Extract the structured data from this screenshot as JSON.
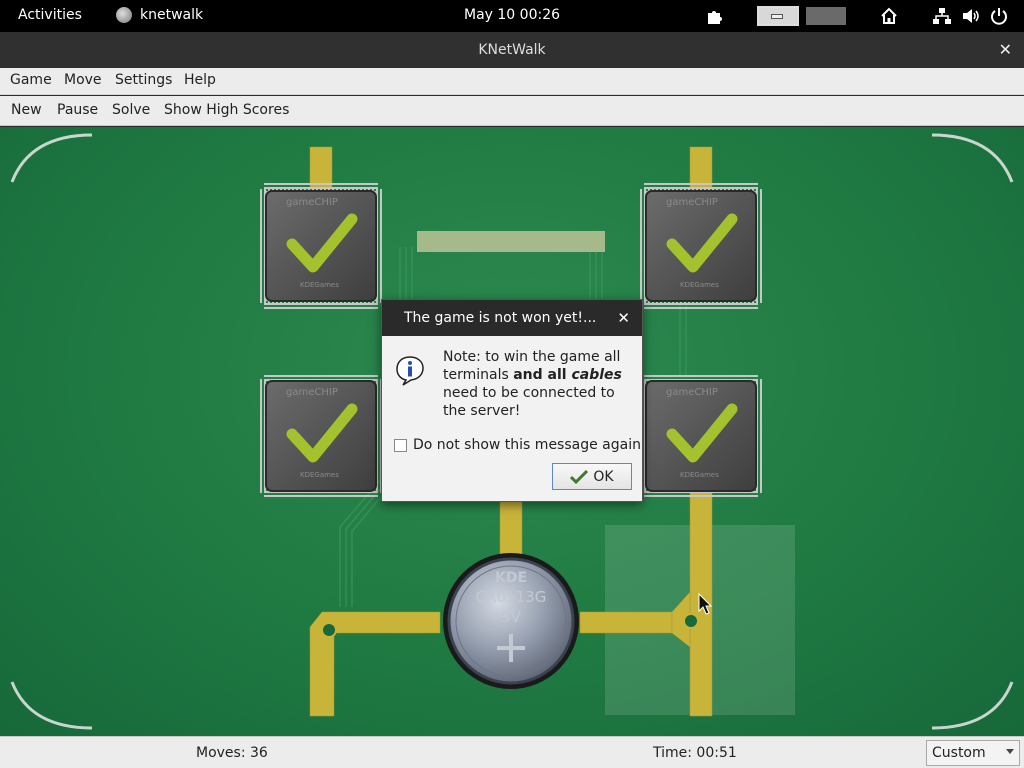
{
  "topbar": {
    "activities": "Activities",
    "app_name": "knetwalk",
    "clock": "May 10  00:26"
  },
  "window": {
    "title": "KNetWalk"
  },
  "menubar": {
    "items": [
      "Game",
      "Move",
      "Settings",
      "Help"
    ]
  },
  "toolbar": {
    "items": [
      "New",
      "Pause",
      "Solve",
      "Show High Scores"
    ]
  },
  "board": {
    "server_label_lines": [
      "KDE",
      "CR0113G",
      "3V"
    ],
    "chip_label": "gameCHIP",
    "chip_maker": "KDEGames",
    "background_color": "#1f7a42",
    "cable_color": "#c9b43a"
  },
  "dialog": {
    "title": "The game is not won yet!...",
    "message_prefix": "Note: to win the game all terminals ",
    "message_bold": "and all ",
    "message_bold_italic": "cables",
    "message_suffix": " need to be connected to the server!",
    "checkbox_label": "Do not show this message again",
    "checkbox_checked": false,
    "ok_label": "OK"
  },
  "statusbar": {
    "moves": "Moves: 36",
    "time": "Time: 00:51",
    "difficulty": "Custom"
  }
}
